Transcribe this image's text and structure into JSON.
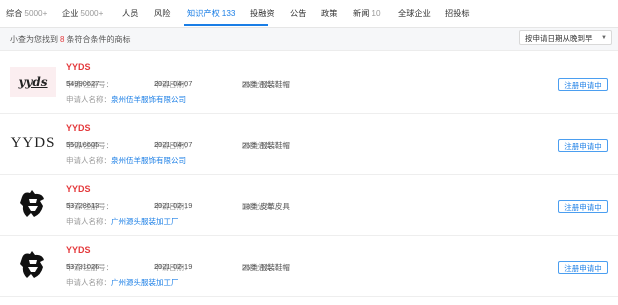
{
  "tabs": [
    {
      "label": "综合",
      "count": "5000+"
    },
    {
      "label": "企业",
      "count": "5000+"
    },
    {
      "label": "人员",
      "count": ""
    },
    {
      "label": "风险",
      "count": ""
    },
    {
      "label": "知识产权",
      "count": "133",
      "active": true
    },
    {
      "label": "投融资",
      "count": ""
    },
    {
      "label": "公告",
      "count": ""
    },
    {
      "label": "政策",
      "count": ""
    },
    {
      "label": "新闻",
      "count": "10"
    },
    {
      "label": "全球企业",
      "count": ""
    },
    {
      "label": "招投标",
      "count": ""
    }
  ],
  "summary": {
    "prefix": "小查为您找到",
    "count": "8",
    "suffix": "条符合条件的商标",
    "sort_label": "按申请日期从晚到早",
    "sort_caret": "▼"
  },
  "labels": {
    "reg_no": "申请/注册号：",
    "apply_date": "申请日期：",
    "intl_class": "国际分类：",
    "applicant": "申请人名称："
  },
  "results": [
    {
      "title": "YYDS",
      "logo_text": "yyds",
      "reg_no": "54990627",
      "apply_date": "2021-04-07",
      "intl_class": "25类 服装鞋帽",
      "applicant": "泉州伍羊服饰有限公司",
      "status": "注册申请中"
    },
    {
      "title": "YYDS",
      "logo_text": "YYDS",
      "reg_no": "55016605",
      "apply_date": "2021-04-07",
      "intl_class": "25类 服装鞋帽",
      "applicant": "泉州伍羊服饰有限公司",
      "status": "注册申请中"
    },
    {
      "title": "YYDS",
      "logo_text": "",
      "reg_no": "53728613",
      "apply_date": "2021-02-19",
      "intl_class": "18类 皮革皮具",
      "applicant": "广州源头服装加工厂",
      "status": "注册申请中"
    },
    {
      "title": "YYDS",
      "logo_text": "",
      "reg_no": "53731026",
      "apply_date": "2021-02-19",
      "intl_class": "25类 服装鞋帽",
      "applicant": "广州源头服装加工厂",
      "status": "注册申请中"
    }
  ]
}
